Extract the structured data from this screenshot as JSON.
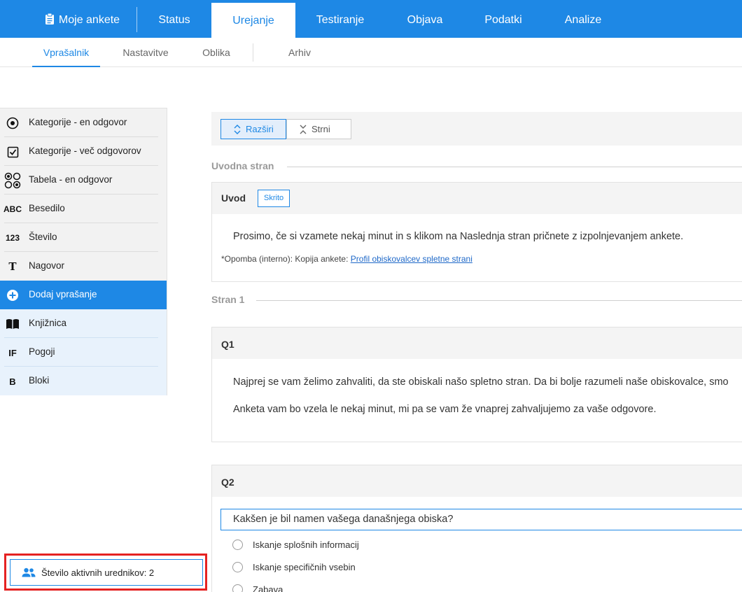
{
  "topnav": {
    "my_surveys": "Moje ankete",
    "tabs": [
      "Status",
      "Urejanje",
      "Testiranje",
      "Objava",
      "Podatki",
      "Analize"
    ],
    "active": "Urejanje"
  },
  "subnav": {
    "tabs": [
      "Vprašalnik",
      "Nastavitve",
      "Oblika",
      "Arhiv"
    ],
    "active": "Vprašalnik"
  },
  "sidebar": {
    "items": [
      {
        "icon": "radio-target-icon",
        "label": "Kategorije - en odgovor"
      },
      {
        "icon": "checkbox-icon",
        "label": "Kategorije - več odgovorov"
      },
      {
        "icon": "grid-circles-icon",
        "label": "Tabela - en odgovor"
      },
      {
        "icon": "abc-icon",
        "icon_text": "ABC",
        "label": "Besedilo"
      },
      {
        "icon": "number-icon",
        "icon_text": "123",
        "label": "Število"
      },
      {
        "icon": "text-t-icon",
        "icon_text": "T",
        "label": "Nagovor"
      },
      {
        "icon": "plus-circle-icon",
        "label": "Dodaj vprašanje"
      },
      {
        "icon": "book-icon",
        "label": "Knjižnica"
      },
      {
        "icon": "if-icon",
        "icon_text": "IF",
        "label": "Pogoji"
      },
      {
        "icon": "b-icon",
        "icon_text": "B",
        "label": "Bloki"
      }
    ],
    "active_editors": "Število aktivnih urednikov: 2"
  },
  "toolbar": {
    "expand": "Razširi",
    "collapse": "Strni"
  },
  "pages": {
    "intro_label": "Uvodna stran",
    "page1_label": "Stran 1"
  },
  "intro_card": {
    "title": "Uvod",
    "badge": "Skrito",
    "text": "Prosimo, če si vzamete nekaj minut in s klikom na Naslednja stran pričnete z izpolnjevanjem ankete.",
    "note_prefix": "*Opomba (interno): Kopija ankete: ",
    "note_link": "Profil obiskovalcev spletne strani"
  },
  "q1": {
    "title": "Q1",
    "line1": "Najprej se vam želimo zahvaliti, da ste obiskali našo spletno stran. Da bi bolje razumeli naše obiskovalce, smo",
    "line2": "Anketa vam bo vzela le nekaj minut, mi pa se vam že vnaprej zahvaljujemo za vaše odgovore."
  },
  "q2": {
    "title": "Q2",
    "question": "Kakšen je bil namen vašega današnjega obiska?",
    "options": [
      "Iskanje splošnih informacij",
      "Iskanje specifičnih vsebin",
      "Zabava"
    ]
  }
}
